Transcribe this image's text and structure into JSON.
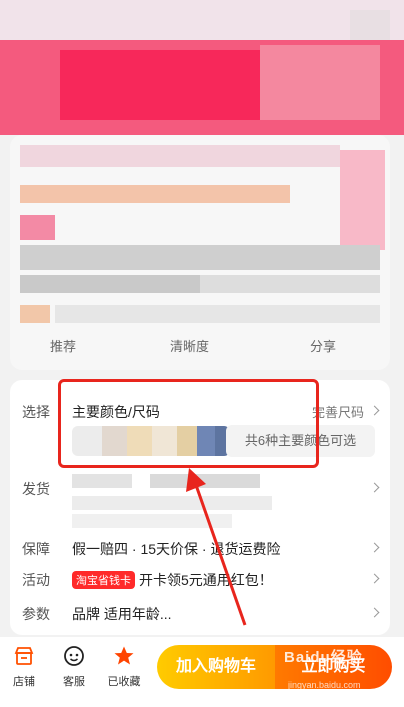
{
  "actions": {
    "recommend": "推荐",
    "compare": "清晰度",
    "share": "分享"
  },
  "options": {
    "select_label": "选择",
    "select_value": "主要颜色/尺码",
    "spec_link": "完善尺码",
    "availability": "共6种主要颜色可选",
    "ship_label": "发货",
    "guarantee_label": "保障",
    "guarantee_value": "假一赔四 · 15天价保 · 退货运费险",
    "promo_label": "活动",
    "promo_tag": "淘宝省钱卡",
    "promo_value": "开卡领5元通用红包！",
    "params_label": "参数",
    "params_value": "品牌  适用年龄..."
  },
  "bottom": {
    "shop": "店铺",
    "service": "客服",
    "favorited": "已收藏",
    "add_cart": "加入购物车",
    "buy_now": "立即购买"
  },
  "watermark": {
    "brand": "Baidu经验",
    "url": "jingyan.baidu.com"
  },
  "colors": {
    "accent": "#ff5000",
    "highlight": "#e8251d",
    "cart_gradient": "#ffcb00",
    "buy_gradient": "#ff4d00"
  }
}
